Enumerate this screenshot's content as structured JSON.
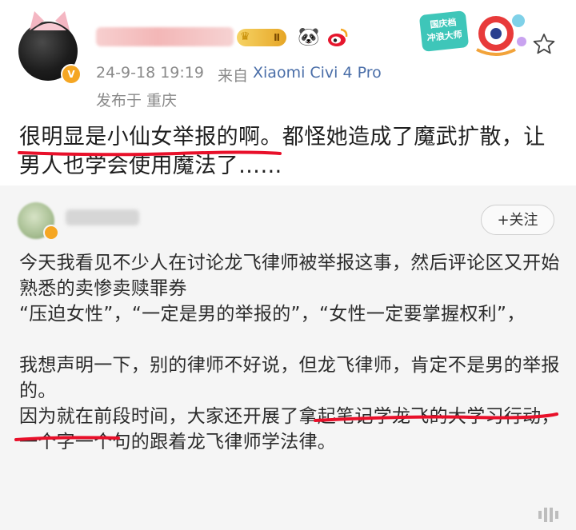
{
  "post": {
    "author": {
      "avatar": "avatar",
      "verified_badge": "v-badge-icon",
      "level_badge": "Ⅱ",
      "icons": [
        "crown-icon",
        "panda-icon",
        "weibo-logo-icon"
      ]
    },
    "time": "24-9-18 19:19",
    "source_prefix": "来自",
    "device": "Xiaomi Civi 4 Pro",
    "location": "发布于 重庆",
    "sticker": {
      "line1": "国庆档",
      "line2": "冲浪大师"
    },
    "text": "很明显是小仙女举报的啊。都怪她造成了魔武扩散，让男人也学会使用魔法了……"
  },
  "quoted": {
    "follow_label": "+关注",
    "paragraphs": [
      "今天我看见不少人在讨论龙飞律师被举报这事，然后评论区又开始熟悉的卖惨卖赎罪券",
      "“压迫女性”，“一定是男的举报的”，“女性一定要掌握权利”，",
      "",
      "我想声明一下，别的律师不好说，但龙飞律师，肯定不是男的举报的。",
      "因为就在前段时间，大家还开展了拿起笔记学龙飞的大学习行动，一个字一个句的跟着龙飞律师学法律。"
    ]
  },
  "colors": {
    "underline": "#e8102a",
    "link_blue": "#4a6ea8",
    "meta_gray": "#8a8a8a",
    "badge_orange": "#f5a623"
  }
}
